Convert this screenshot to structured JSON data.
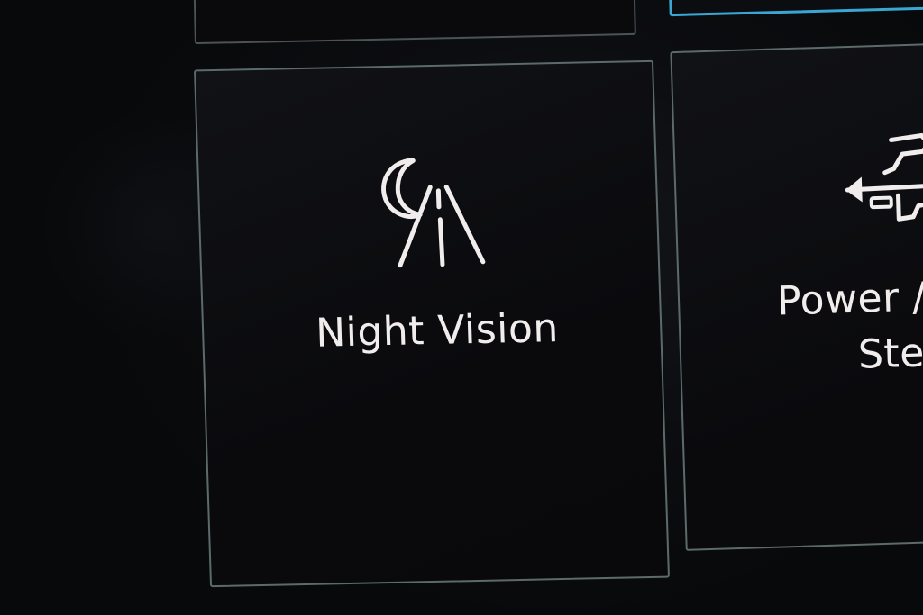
{
  "tiles": {
    "top_left": {},
    "top_right": {
      "accent_color": "#3aa6d4"
    },
    "night_vision": {
      "label": "Night Vision",
      "icon": "night-vision-icon"
    },
    "power_steering": {
      "label_line1": "Power /",
      "label_line2": "Ste",
      "icon": "steering-arrows-icon"
    }
  },
  "colors": {
    "background": "#0b0c0f",
    "tile_border": "#5c6a6b",
    "text": "#f2eded"
  }
}
